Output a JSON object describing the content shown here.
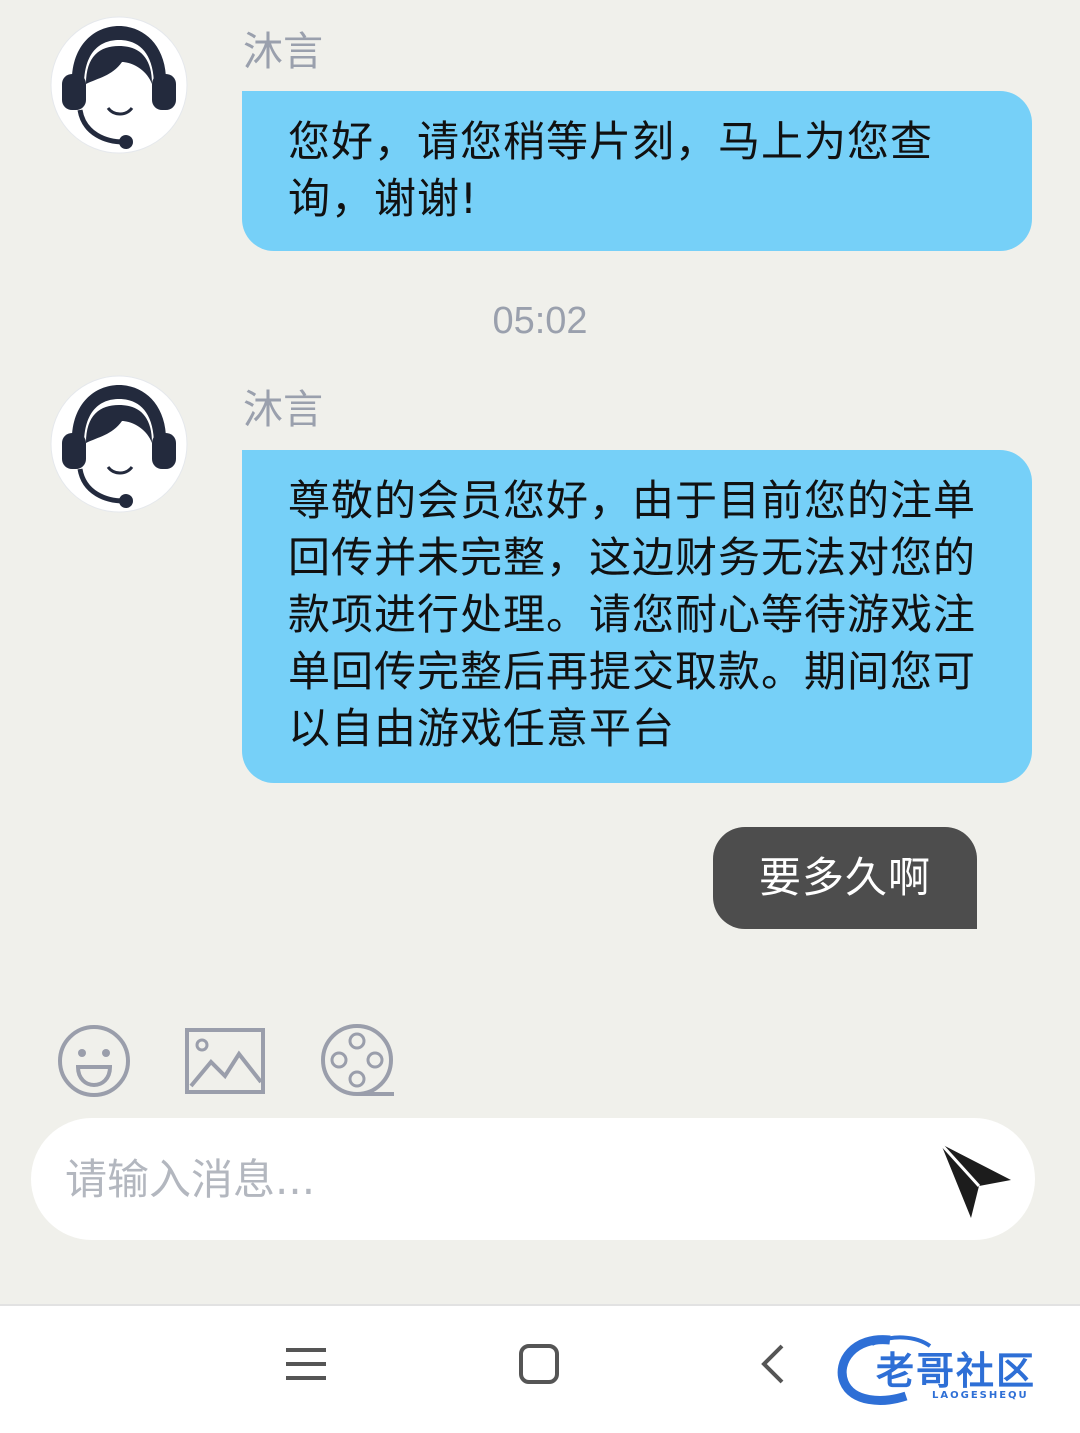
{
  "messages": [
    {
      "sender": "沐言",
      "text": "您好，请您稍等片刻，马上为您查询，谢谢!",
      "avatar_icon": "customer-service-headset-icon"
    },
    {
      "sender": "沐言",
      "text": "尊敬的会员您好，由于目前您的注单回传并未完整，这边财务无法对您的款项进行处理。请您耐心等待游戏注单回传完整后再提交取款。期间您可以自由游戏任意平台",
      "avatar_icon": "customer-service-headset-icon"
    }
  ],
  "timestamp": "05:02",
  "reply": "要多久啊",
  "toolbar": {
    "emoji_icon": "emoji-icon",
    "image_icon": "image-icon",
    "video_icon": "video-reel-icon"
  },
  "composer": {
    "placeholder": "请输入消息...",
    "send_icon": "send-icon"
  },
  "navbar": {
    "menu_icon": "menu-icon",
    "home_icon": "home-square-icon",
    "back_icon": "back-chevron-icon"
  },
  "watermark": {
    "title": "老哥社区",
    "subtitle": "LAOGESHEQU"
  },
  "colors": {
    "background": "#f0f0eb",
    "incoming_bubble": "#76d0f8",
    "outgoing_bubble": "#4d4d4d",
    "muted_text": "#9aa0ad",
    "icon_gray": "#9a9eab",
    "watermark_blue": "#2e6fd6"
  }
}
